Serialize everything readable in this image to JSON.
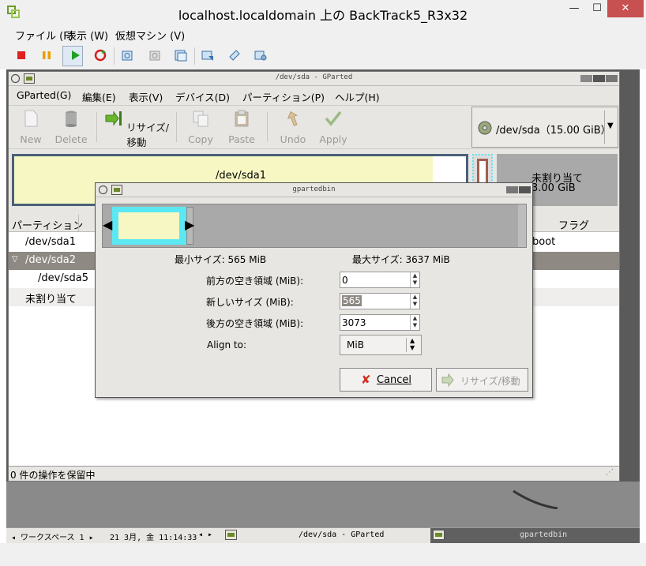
{
  "vm": {
    "title": "localhost.localdomain 上の BackTrack5_R3x32",
    "menu": [
      "ファイル (F)",
      "表示 (W)",
      "仮想マシン (V)"
    ],
    "win_controls": {
      "min": "—",
      "max": "☐",
      "close": "✕"
    }
  },
  "gparted": {
    "title": "/dev/sda - GParted",
    "menu": [
      "GParted(G)",
      "編集(E)",
      "表示(V)",
      "デバイス(D)",
      "パーティション(P)",
      "ヘルプ(H)"
    ],
    "toolbar": {
      "new": "New",
      "delete": "Delete",
      "resize": "リサイズ/移動",
      "copy": "Copy",
      "paste": "Paste",
      "undo": "Undo",
      "apply": "Apply"
    },
    "device": "/dev/sda（15.00 GiB）",
    "map": {
      "sda1": "/dev/sda1",
      "unalloc_label": "未割り当て",
      "unalloc_size": "3.00 GiB"
    },
    "columns": {
      "partition": "パーティション",
      "flags": "フラグ"
    },
    "rows": [
      {
        "name": "/dev/sda1",
        "flag": "boot"
      },
      {
        "name": "/dev/sda2",
        "flag": ""
      },
      {
        "name": "/dev/sda5",
        "flag": ""
      },
      {
        "name": "未割り当て",
        "flag": ""
      }
    ],
    "status": "0 件の操作を保留中"
  },
  "dialog": {
    "title": "gpartedbin",
    "min_size": "最小サイズ: 565 MiB",
    "max_size": "最大サイズ: 3637 MiB",
    "free_before_label": "前方の空き領域 (MiB):",
    "free_before_value": "0",
    "new_size_label": "新しいサイズ (MiB):",
    "new_size_value": "565",
    "free_after_label": "後方の空き領域 (MiB):",
    "free_after_value": "3073",
    "align_label": "Align to:",
    "align_value": "MiB",
    "cancel": "Cancel",
    "resize": "リサイズ/移動"
  },
  "taskbar": {
    "workspace": "◂ ワークスペース 1 ▸",
    "clock": "21 3月, 金 11:14:33",
    "task1": "/dev/sda - GParted",
    "task2": "gpartedbin"
  },
  "colors": {
    "used": "#f7f7c4",
    "selected_border": "#5ce8f3",
    "unallocated": "#a9a9a9",
    "sda2_row": "#8e8983"
  }
}
